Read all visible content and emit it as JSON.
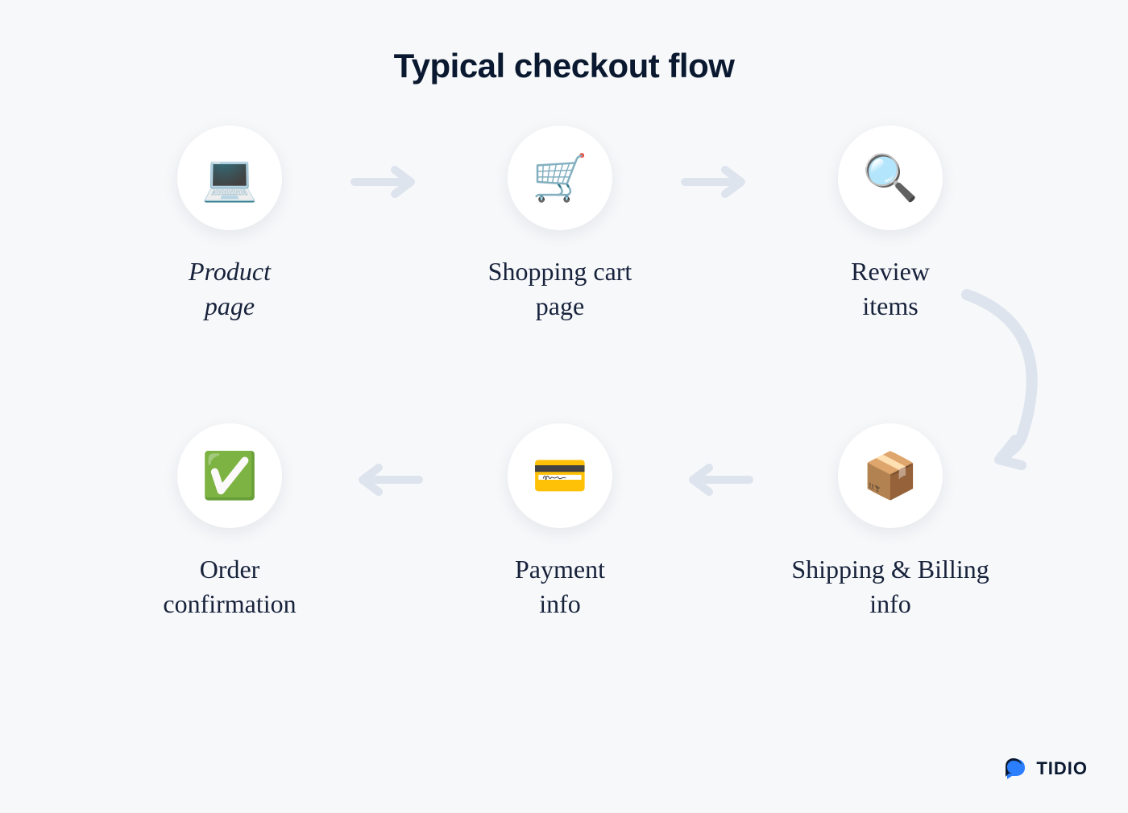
{
  "title": "Typical checkout flow",
  "steps": [
    {
      "label": "Product\npage",
      "icon": "💻",
      "icon_name": "laptop-icon",
      "italic": true
    },
    {
      "label": "Shopping cart\npage",
      "icon": "🛒",
      "icon_name": "shopping-cart-icon",
      "italic": false
    },
    {
      "label": "Review\nitems",
      "icon": "🔍",
      "icon_name": "magnifying-glass-icon",
      "italic": false
    },
    {
      "label": "Shipping & Billing\ninfo",
      "icon": "📦",
      "icon_name": "package-icon",
      "italic": false
    },
    {
      "label": "Payment\ninfo",
      "icon": "💳",
      "icon_name": "credit-card-icon",
      "italic": false
    },
    {
      "label": "Order\nconfirmation",
      "icon": "✅",
      "icon_name": "checkmark-icon",
      "italic": false
    }
  ],
  "brand": {
    "name": "TIDIO"
  },
  "colors": {
    "background": "#f7f8fa",
    "text_dark": "#0a1930",
    "step_text": "#17223b",
    "arrow": "#dde4ee",
    "circle_bg": "#ffffff",
    "brand_blue": "#2b7fff",
    "brand_dark": "#0a1930"
  }
}
